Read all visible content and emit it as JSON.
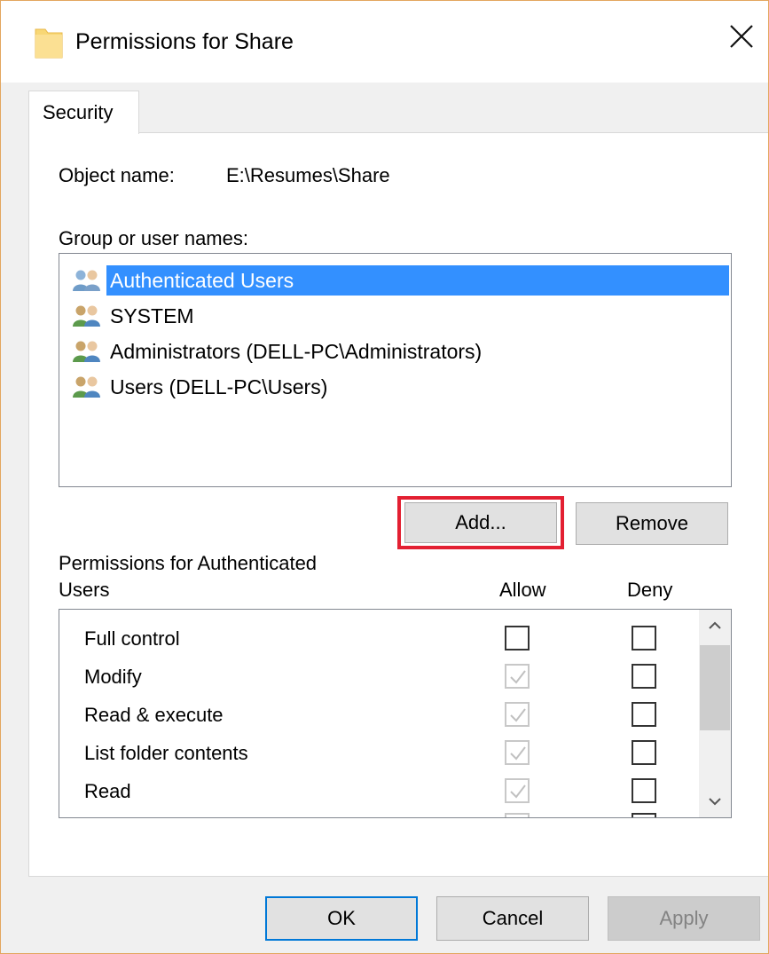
{
  "window": {
    "title": "Permissions for Share",
    "icon": "folder-icon"
  },
  "tabs": [
    {
      "label": "Security",
      "selected": true
    }
  ],
  "object": {
    "label": "Object name:",
    "value": "E:\\Resumes\\Share"
  },
  "groups": {
    "label": "Group or user names:",
    "items": [
      {
        "label": "Authenticated Users",
        "selected": true,
        "icon": "user-group-icon"
      },
      {
        "label": "SYSTEM",
        "selected": false,
        "icon": "user-group-icon"
      },
      {
        "label": "Administrators (DELL-PC\\Administrators)",
        "selected": false,
        "icon": "user-group-icon"
      },
      {
        "label": "Users (DELL-PC\\Users)",
        "selected": false,
        "icon": "user-group-icon"
      }
    ],
    "add_label": "Add...",
    "remove_label": "Remove"
  },
  "permissions": {
    "title_line1": "Permissions for Authenticated",
    "title_line2": "Users",
    "allow_header": "Allow",
    "deny_header": "Deny",
    "rows": [
      {
        "label": "Full control",
        "allow": false,
        "allow_disabled": false,
        "deny": false
      },
      {
        "label": "Modify",
        "allow": true,
        "allow_disabled": true,
        "deny": false
      },
      {
        "label": "Read & execute",
        "allow": true,
        "allow_disabled": true,
        "deny": false
      },
      {
        "label": "List folder contents",
        "allow": true,
        "allow_disabled": true,
        "deny": false
      },
      {
        "label": "Read",
        "allow": true,
        "allow_disabled": true,
        "deny": false
      }
    ]
  },
  "footer": {
    "ok_label": "OK",
    "cancel_label": "Cancel",
    "apply_label": "Apply"
  },
  "colors": {
    "selection": "#3390ff",
    "highlight_box": "#e32032",
    "default_button_border": "#0078d7"
  }
}
